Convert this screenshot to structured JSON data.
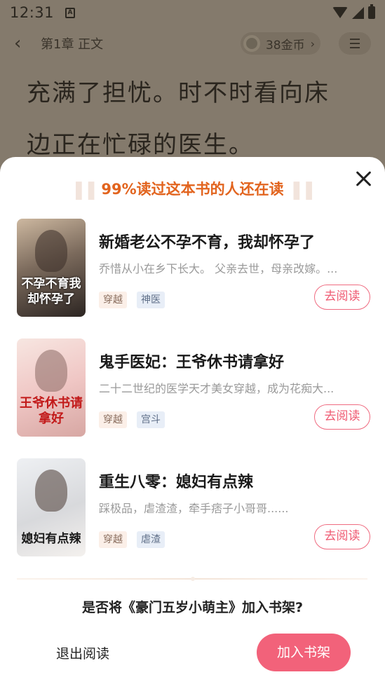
{
  "status_bar": {
    "time": "12:31",
    "notif_letter": "A"
  },
  "reader": {
    "chapter_title": "第1章 正文",
    "coins": "38金币",
    "text_lines": [
      "充满了担忧。时不时看向床",
      "边正在忙碌的医生。"
    ]
  },
  "sheet": {
    "title": "99%读过这本书的人还在读",
    "books": [
      {
        "title": "新婚老公不孕不育，我却怀孕了",
        "desc": "乔惜从小在乡下长大。 父亲去世，母亲改嫁。...",
        "tags": [
          "穿越",
          "神医"
        ],
        "cover_text": "不孕不育我却怀孕了",
        "read_label": "去阅读"
      },
      {
        "title": "鬼手医妃：王爷休书请拿好",
        "desc": "二十二世纪的医学天才美女穿越，成为花痴大...",
        "tags": [
          "穿越",
          "宫斗"
        ],
        "cover_text": "王爷休书请拿好",
        "read_label": "去阅读"
      },
      {
        "title": "重生八零：媳妇有点辣",
        "desc": "踩极品，虐渣渣，牵手痞子小哥哥......",
        "tags": [
          "穿越",
          "虐渣"
        ],
        "cover_text": "媳妇有点辣",
        "read_label": "去阅读"
      }
    ],
    "prompt": "是否将《豪门五岁小萌主》加入书架?",
    "exit_label": "退出阅读",
    "add_label": "加入书架"
  },
  "colors": {
    "accent_pink": "#f2627a",
    "title_orange": "#e2641e",
    "dim_background": "#847a6c"
  },
  "icons": [
    "back-icon",
    "coin-icon",
    "chevron-right-icon",
    "menu-icon",
    "close-icon",
    "wifi-icon",
    "signal-icon",
    "battery-icon"
  ]
}
